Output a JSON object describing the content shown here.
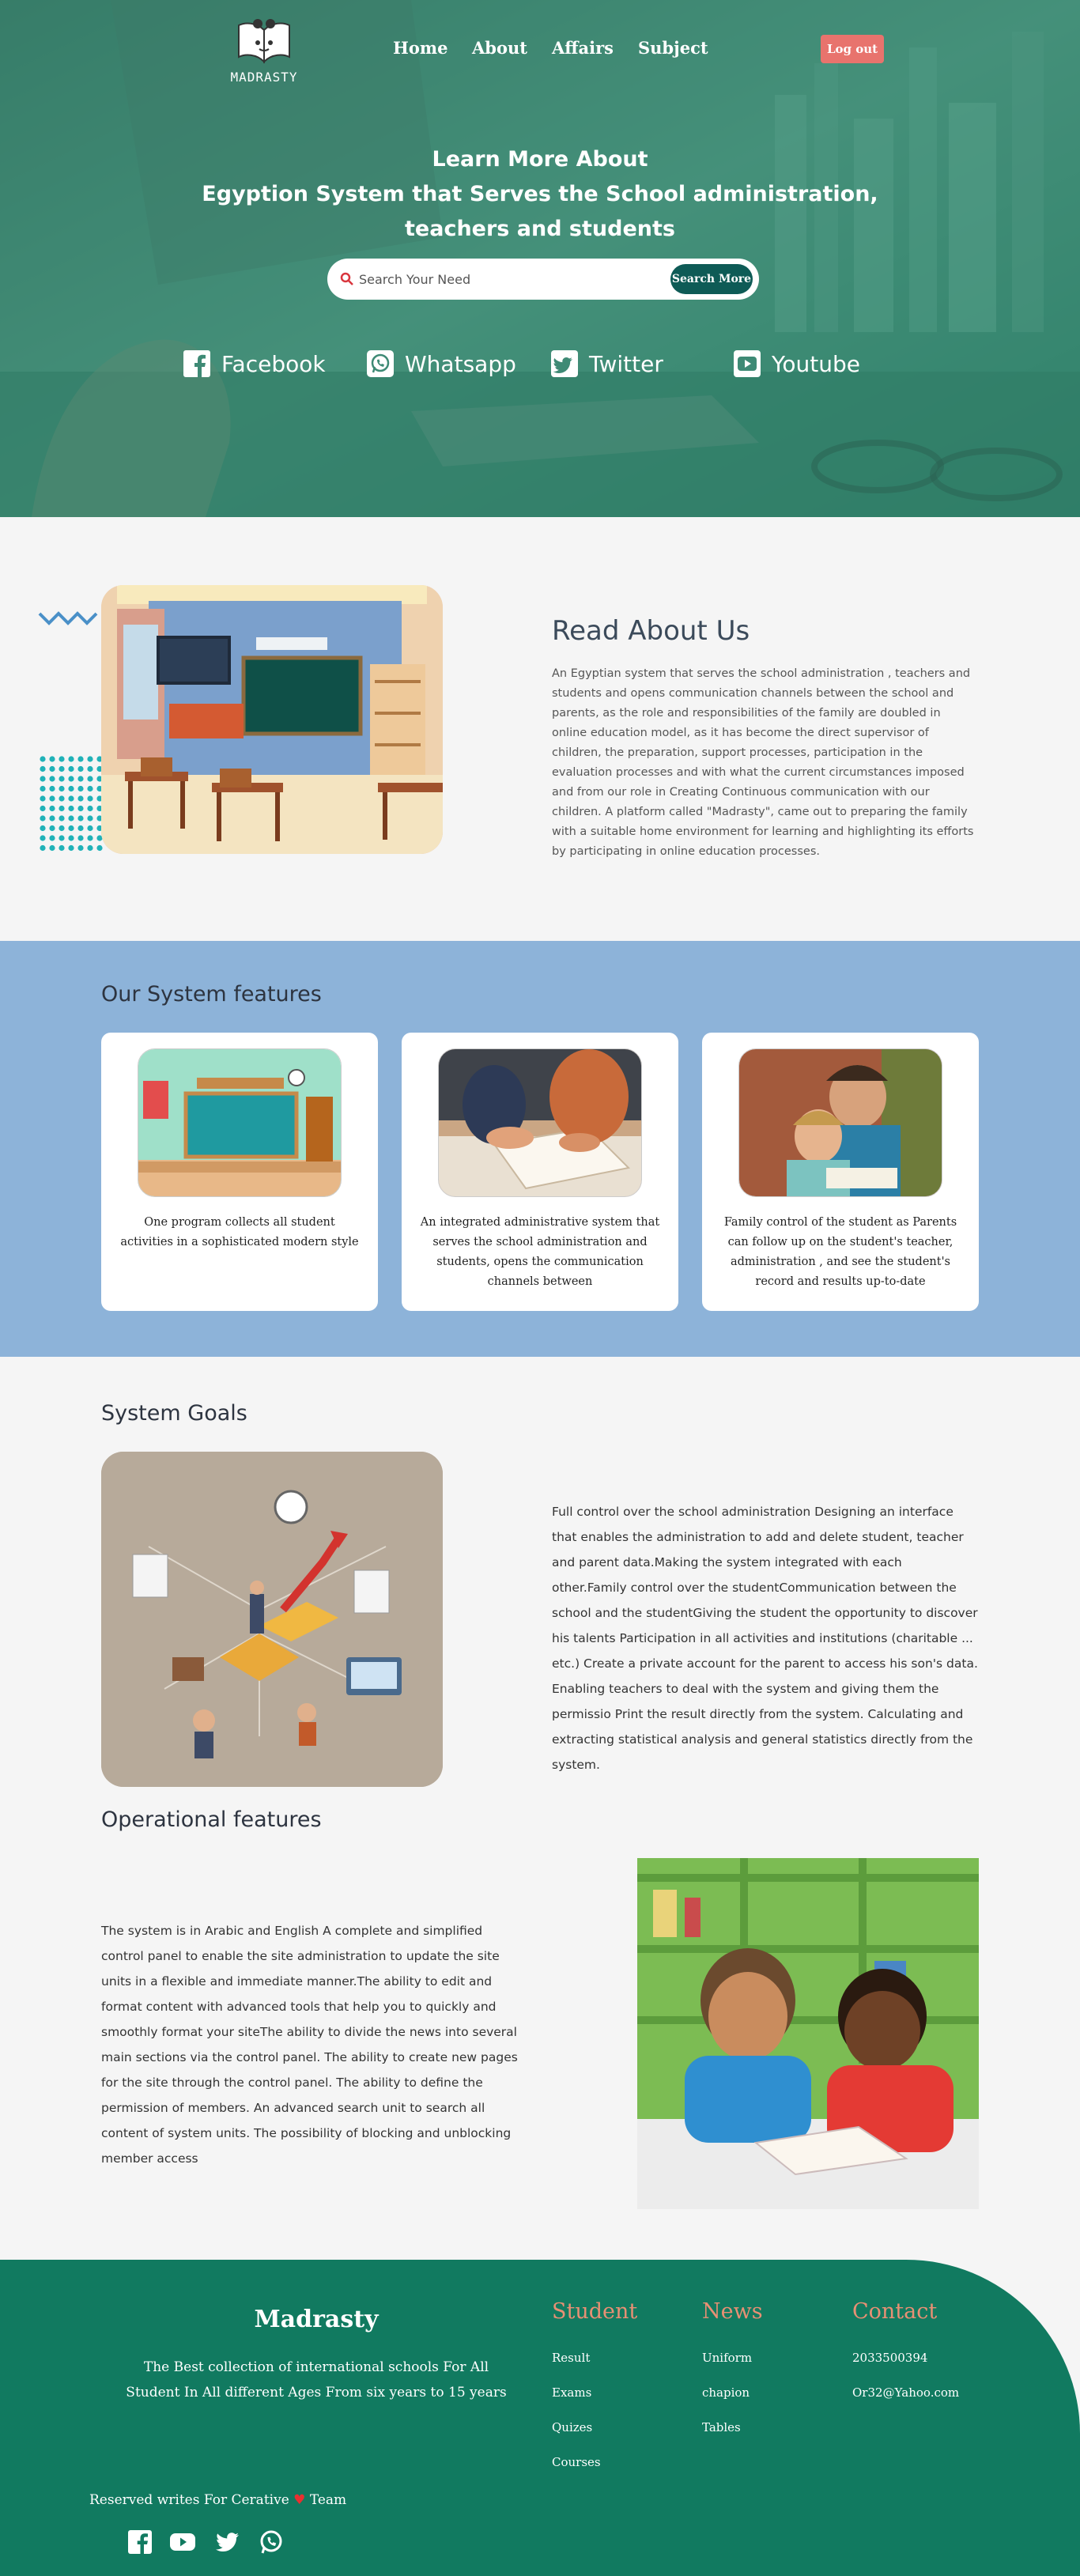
{
  "brand": {
    "logo_text": "MADRASTY"
  },
  "nav": {
    "items": [
      {
        "label": "Home"
      },
      {
        "label": "About"
      },
      {
        "label": "Affairs"
      },
      {
        "label": "Subject"
      }
    ],
    "logout_label": "Log out"
  },
  "hero": {
    "title_line1": "Learn More About",
    "title_line2": "Egyption System that Serves the School administration,",
    "title_line3": "teachers and students",
    "search_placeholder": "Search Your Need",
    "search_button": "Search More",
    "social": [
      {
        "label": "Facebook",
        "icon": "facebook-icon"
      },
      {
        "label": "Whatsapp",
        "icon": "whatsapp-icon"
      },
      {
        "label": "Twitter",
        "icon": "twitter-icon"
      },
      {
        "label": "Youtube",
        "icon": "youtube-icon"
      }
    ]
  },
  "about": {
    "title": "Read About Us",
    "text": "An Egyptian system that serves the school administration , teachers and students and opens communication channels between the school and parents, as the role and responsibilities of the family are doubled in online education model, as it has become the direct supervisor of children, the preparation, support processes, participation in the evaluation processes and with what the current circumstances imposed and from our role in Creating Continuous communication with our children. A platform called \"Madrasty\", came out to preparing the family with a suitable home environment for learning and highlighting its efforts by participating in online education processes."
  },
  "features": {
    "title": "Our System features",
    "cards": [
      {
        "text": "One program collects all student activities in a sophisticated modern style"
      },
      {
        "text": "An integrated administrative system that serves the school administration and students, opens the communication channels between"
      },
      {
        "text": "Family control of the student as Parents can follow up on the student's teacher, administration , and see the student's record and results up-to-date"
      }
    ]
  },
  "goals": {
    "title": "System Goals",
    "text": "Full control over the school administration Designing an interface that enables the administration to add and delete student, teacher and parent data.Making the system integrated with each other.Family control over the studentCommunication between the school and the studentGiving the student the opportunity to discover his talents Participation in all activities and institutions (charitable ... etc.) Create a private account for the parent to access his son's data. Enabling teachers to deal with the system and giving them the permissio Print the result directly from the system. Calculating and extracting statistical analysis and general statistics directly from the system."
  },
  "operational": {
    "title": "Operational features",
    "text": "The system is in Arabic and English A complete and simplified control panel to enable the site administration to update the site units in a flexible and immediate manner.The ability to edit and format content with advanced tools that help you to quickly and smoothly format your siteThe ability to divide the news into several main sections via the control panel. The ability to create new pages for the site through the control panel. The ability to define the permission of members. An advanced search unit to search all content of system units. The possibility of blocking and unblocking member access"
  },
  "footer": {
    "brand": "Madrasty",
    "description": "The Best collection of international schools For All Student In All different Ages From six years to 15 years",
    "columns": [
      {
        "title": "Student",
        "links": [
          "Result",
          "Exams",
          "Quizes",
          "Courses"
        ]
      },
      {
        "title": "News",
        "links": [
          "Uniform",
          "chapion",
          "Tables"
        ]
      },
      {
        "title": "Contact",
        "links": [
          "2033500394",
          "Or32@Yahoo.com"
        ]
      }
    ],
    "reserved_before": "Reserved writes For Cerative",
    "reserved_after": "Team",
    "accent_color": "#e89074",
    "background_color": "#117a60"
  }
}
